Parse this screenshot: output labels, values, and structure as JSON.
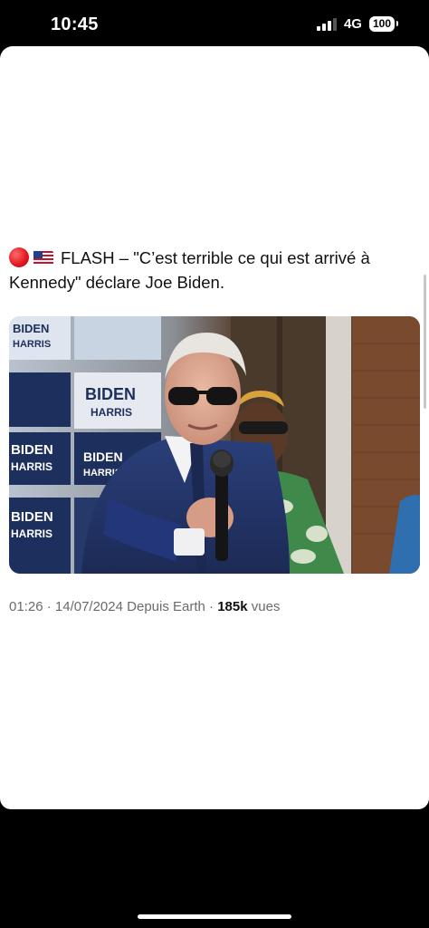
{
  "status_bar": {
    "time": "10:45",
    "network": "4G",
    "battery": "100",
    "signal_bars_active": 3,
    "signal_bars_total": 4
  },
  "tweet": {
    "text": "FLASH – \"C’est terrible ce qui est arrivé à Kennedy\" déclare Joe Biden.",
    "emoji_icons": [
      "red-circle-icon",
      "us-flag-icon"
    ],
    "time": "01:26",
    "separator": "·",
    "date": "14/07/2024",
    "source": "Depuis Earth",
    "views_count": "185k",
    "views_label": "vues"
  },
  "media": {
    "signs": [
      {
        "line1": "BIDEN",
        "line2": "HARRIS"
      },
      {
        "line1": "BIDEN",
        "line2": "HARRIS"
      },
      {
        "line1": "BIDEN",
        "line2": "HARRIS"
      },
      {
        "line1": "BIDEN",
        "line2": "HARRIS"
      },
      {
        "line1": "BIDEN",
        "line2": "HARRIS"
      }
    ]
  },
  "colors": {
    "background": "#000000",
    "card": "#ffffff",
    "text": "#111111",
    "meta_text": "#6b6b6b",
    "sign_navy": "#1d2f5c",
    "suit_navy": "#22356b"
  }
}
